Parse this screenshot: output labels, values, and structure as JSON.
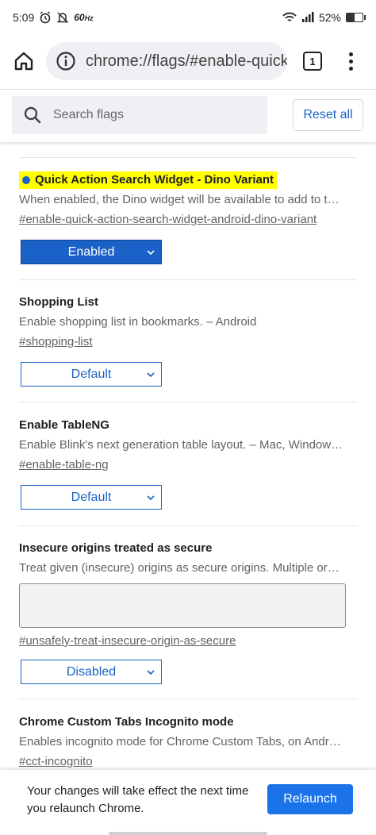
{
  "status": {
    "time": "5:09",
    "rate": "60",
    "rate_unit": "Hz",
    "battery": "52%",
    "battery_level": 0.52
  },
  "toolbar": {
    "url": "chrome://flags/#enable-quick",
    "tab_count": "1"
  },
  "search": {
    "placeholder": "Search flags",
    "reset_label": "Reset all"
  },
  "flags": [
    {
      "title": "Quick Action Search Widget - Dino Variant",
      "description": "When enabled, the Dino widget will be available to add to t…",
      "anchor": "#enable-quick-action-search-widget-android-dino-variant",
      "state": "Enabled",
      "highlighted": true
    },
    {
      "title": "Shopping List",
      "description": "Enable shopping list in bookmarks. – Android",
      "anchor": "#shopping-list",
      "state": "Default"
    },
    {
      "title": "Enable TableNG",
      "description": "Enable Blink's next generation table layout. – Mac, Window…",
      "anchor": "#enable-table-ng",
      "state": "Default"
    },
    {
      "title": "Insecure origins treated as secure",
      "description": "Treat given (insecure) origins as secure origins. Multiple or…",
      "anchor": "#unsafely-treat-insecure-origin-as-secure",
      "state": "Disabled"
    },
    {
      "title": "Chrome Custom Tabs Incognito mode",
      "description": "Enables incognito mode for Chrome Custom Tabs, on Andr…",
      "anchor": "#cct-incognito"
    }
  ],
  "footer": {
    "message": "Your changes will take effect the next time you relaunch Chrome.",
    "relaunch_label": "Relaunch"
  },
  "colors": {
    "accent": "#1a73e8",
    "link_blue": "#1a62c7",
    "highlight": "#ffff00"
  }
}
